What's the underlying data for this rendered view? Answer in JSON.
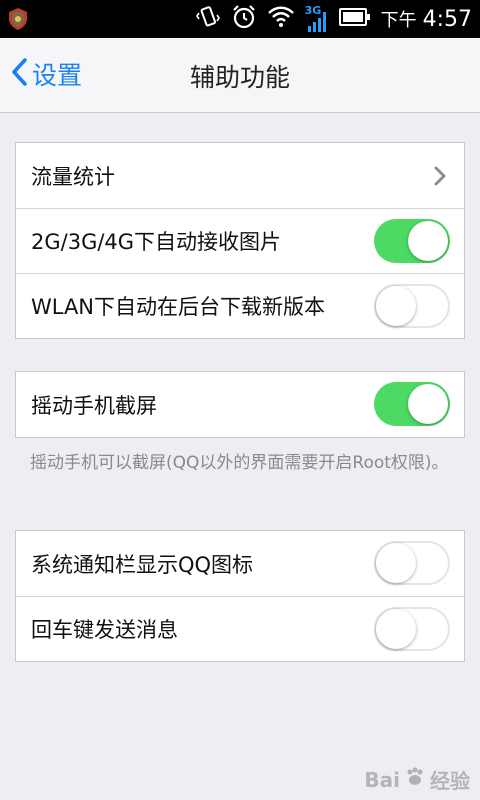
{
  "statusbar": {
    "ampm": "下午",
    "time": "4:57",
    "network": "3G"
  },
  "nav": {
    "back_label": "设置",
    "title": "辅助功能"
  },
  "groups": [
    {
      "rows": [
        {
          "label": "流量统计",
          "control": "chevron"
        },
        {
          "label": "2G/3G/4G下自动接收图片",
          "control": "toggle",
          "on": true
        },
        {
          "label": "WLAN下自动在后台下载新版本",
          "control": "toggle",
          "on": false
        }
      ]
    },
    {
      "rows": [
        {
          "label": "摇动手机截屏",
          "control": "toggle",
          "on": true
        }
      ],
      "footnote": "摇动手机可以截屏(QQ以外的界面需要开启Root权限)。"
    },
    {
      "rows": [
        {
          "label": "系统通知栏显示QQ图标",
          "control": "toggle",
          "on": false
        },
        {
          "label": "回车键发送消息",
          "control": "toggle",
          "on": false
        }
      ]
    }
  ],
  "watermark": {
    "text": "Bai",
    "text2": "经验"
  },
  "colors": {
    "accent": "#1a82f0",
    "toggle_on": "#4cd964"
  },
  "icons": [
    "app-shield-icon",
    "vibrate-icon",
    "alarm-icon",
    "wifi-icon",
    "signal-icon",
    "battery-icon",
    "back-chevron-icon",
    "chevron-right-icon",
    "baidu-paw-icon"
  ]
}
